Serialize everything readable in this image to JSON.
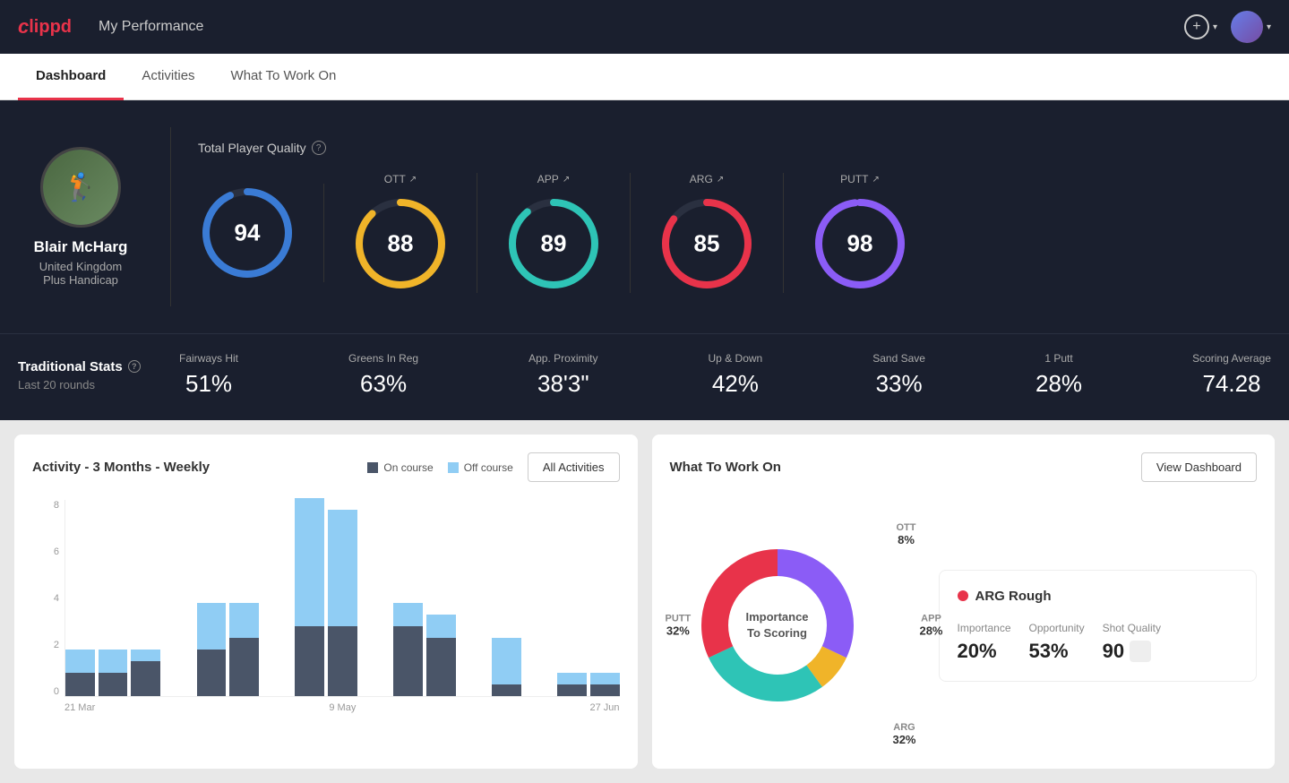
{
  "header": {
    "logo": "clippd",
    "title": "My Performance",
    "add_button_label": "+",
    "chevron": "▾"
  },
  "nav": {
    "tabs": [
      {
        "id": "dashboard",
        "label": "Dashboard",
        "active": true
      },
      {
        "id": "activities",
        "label": "Activities",
        "active": false
      },
      {
        "id": "what-to-work-on",
        "label": "What To Work On",
        "active": false
      }
    ]
  },
  "player": {
    "name": "Blair McHarg",
    "country": "United Kingdom",
    "handicap": "Plus Handicap",
    "avatar_emoji": "🏌️"
  },
  "total_quality": {
    "label": "Total Player Quality",
    "scores": [
      {
        "id": "total",
        "label": "",
        "value": "94",
        "color": "#3a7bd5",
        "pct": 94
      },
      {
        "id": "ott",
        "label": "OTT",
        "value": "88",
        "color": "#f0b429",
        "pct": 88
      },
      {
        "id": "app",
        "label": "APP",
        "value": "89",
        "color": "#2ec4b6",
        "pct": 89
      },
      {
        "id": "arg",
        "label": "ARG",
        "value": "85",
        "color": "#e8334a",
        "pct": 85
      },
      {
        "id": "putt",
        "label": "PUTT",
        "value": "98",
        "color": "#8b5cf6",
        "pct": 98
      }
    ]
  },
  "traditional_stats": {
    "label": "Traditional Stats",
    "help": "?",
    "sublabel": "Last 20 rounds",
    "stats": [
      {
        "id": "fairways",
        "label": "Fairways Hit",
        "value": "51%"
      },
      {
        "id": "greens",
        "label": "Greens In Reg",
        "value": "63%"
      },
      {
        "id": "app_prox",
        "label": "App. Proximity",
        "value": "38'3\""
      },
      {
        "id": "updown",
        "label": "Up & Down",
        "value": "42%"
      },
      {
        "id": "sand_save",
        "label": "Sand Save",
        "value": "33%"
      },
      {
        "id": "one_putt",
        "label": "1 Putt",
        "value": "28%"
      },
      {
        "id": "scoring",
        "label": "Scoring Average",
        "value": "74.28"
      }
    ]
  },
  "activity_chart": {
    "title": "Activity - 3 Months - Weekly",
    "legend": [
      {
        "label": "On course",
        "color": "#4a5568"
      },
      {
        "label": "Off course",
        "color": "#90cdf4"
      }
    ],
    "all_activities_btn": "All Activities",
    "y_labels": [
      "8",
      "6",
      "4",
      "2",
      "0"
    ],
    "x_labels": [
      "21 Mar",
      "9 May",
      "27 Jun"
    ],
    "bars": [
      {
        "on": 1,
        "off": 1
      },
      {
        "on": 1,
        "off": 1
      },
      {
        "on": 1.5,
        "off": 0.5
      },
      {
        "on": 0,
        "off": 0
      },
      {
        "on": 2,
        "off": 2
      },
      {
        "on": 2.5,
        "off": 1.5
      },
      {
        "on": 0,
        "off": 0
      },
      {
        "on": 3,
        "off": 5.5
      },
      {
        "on": 3,
        "off": 5
      },
      {
        "on": 0,
        "off": 0
      },
      {
        "on": 3,
        "off": 1
      },
      {
        "on": 2.5,
        "off": 1
      },
      {
        "on": 0,
        "off": 0
      },
      {
        "on": 0.5,
        "off": 2
      },
      {
        "on": 0,
        "off": 0
      },
      {
        "on": 0.5,
        "off": 0.5
      },
      {
        "on": 0.5,
        "off": 0.5
      }
    ]
  },
  "what_to_work_on": {
    "title": "What To Work On",
    "view_dashboard_btn": "View Dashboard",
    "donut_center": "Importance\nTo Scoring",
    "segments": [
      {
        "label": "OTT",
        "pct": "8%",
        "color": "#f0b429",
        "value": 8
      },
      {
        "label": "APP",
        "pct": "28%",
        "color": "#2ec4b6",
        "value": 28
      },
      {
        "label": "ARG",
        "pct": "32%",
        "color": "#e8334a",
        "value": 32
      },
      {
        "label": "PUTT",
        "pct": "32%",
        "color": "#8b5cf6",
        "value": 32
      }
    ],
    "highlight": {
      "title": "ARG Rough",
      "dot_color": "#e8334a",
      "stats": [
        {
          "label": "Importance",
          "value": "20%"
        },
        {
          "label": "Opportunity",
          "value": "53%"
        },
        {
          "label": "Shot Quality",
          "value": "90"
        }
      ]
    }
  }
}
